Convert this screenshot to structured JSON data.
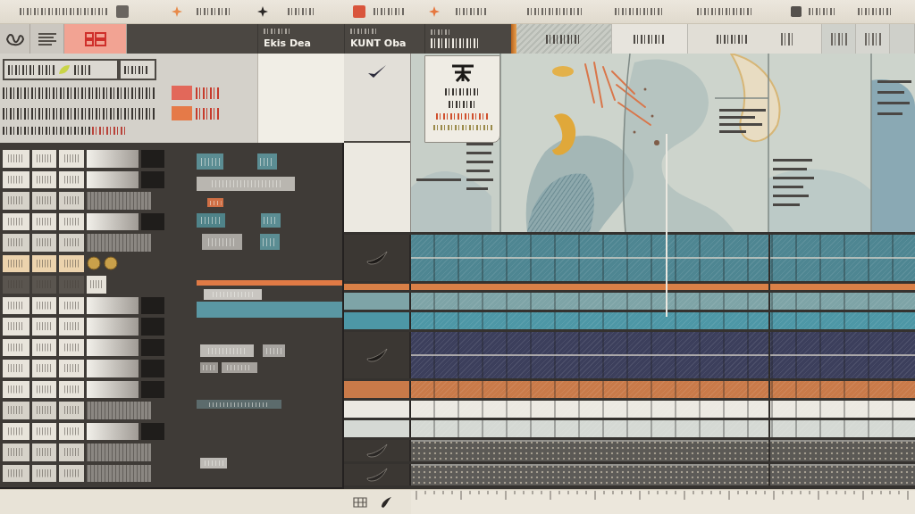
{
  "mode_tabs": [
    {
      "selected": false
    },
    {
      "selected": false
    },
    {
      "selected": true
    }
  ],
  "column_headers": [
    {
      "label": "Ekis Dea"
    },
    {
      "label": "KUNT Oba"
    }
  ],
  "status_tags": [
    {
      "color": "#e2685a"
    },
    {
      "color": "#e57a48"
    }
  ],
  "list_rows": [
    {
      "kind": "standard"
    },
    {
      "kind": "standard"
    },
    {
      "kind": "short"
    },
    {
      "kind": "standard"
    },
    {
      "kind": "short"
    },
    {
      "kind": "warm"
    },
    {
      "kind": "dark"
    },
    {
      "kind": "standard"
    },
    {
      "kind": "standard"
    },
    {
      "kind": "standard"
    },
    {
      "kind": "standard"
    },
    {
      "kind": "standard"
    },
    {
      "kind": "short"
    },
    {
      "kind": "standard"
    },
    {
      "kind": "short"
    },
    {
      "kind": "short"
    }
  ],
  "tracks": [
    {
      "kind": "main",
      "color": "#4e8692"
    },
    {
      "kind": "stripe",
      "color": "#d98047"
    },
    {
      "kind": "band",
      "color": "#7ea4a7"
    },
    {
      "kind": "band",
      "color": "#4d97a6"
    },
    {
      "kind": "main",
      "color": "#3c3f5c"
    },
    {
      "kind": "band",
      "color": "#c97a49"
    },
    {
      "kind": "band",
      "color": "#ece9e2"
    },
    {
      "kind": "band",
      "color": "#d5d9d4"
    },
    {
      "kind": "pattern",
      "color": "#5b5955"
    },
    {
      "kind": "pattern",
      "color": "#5d5b58"
    }
  ]
}
